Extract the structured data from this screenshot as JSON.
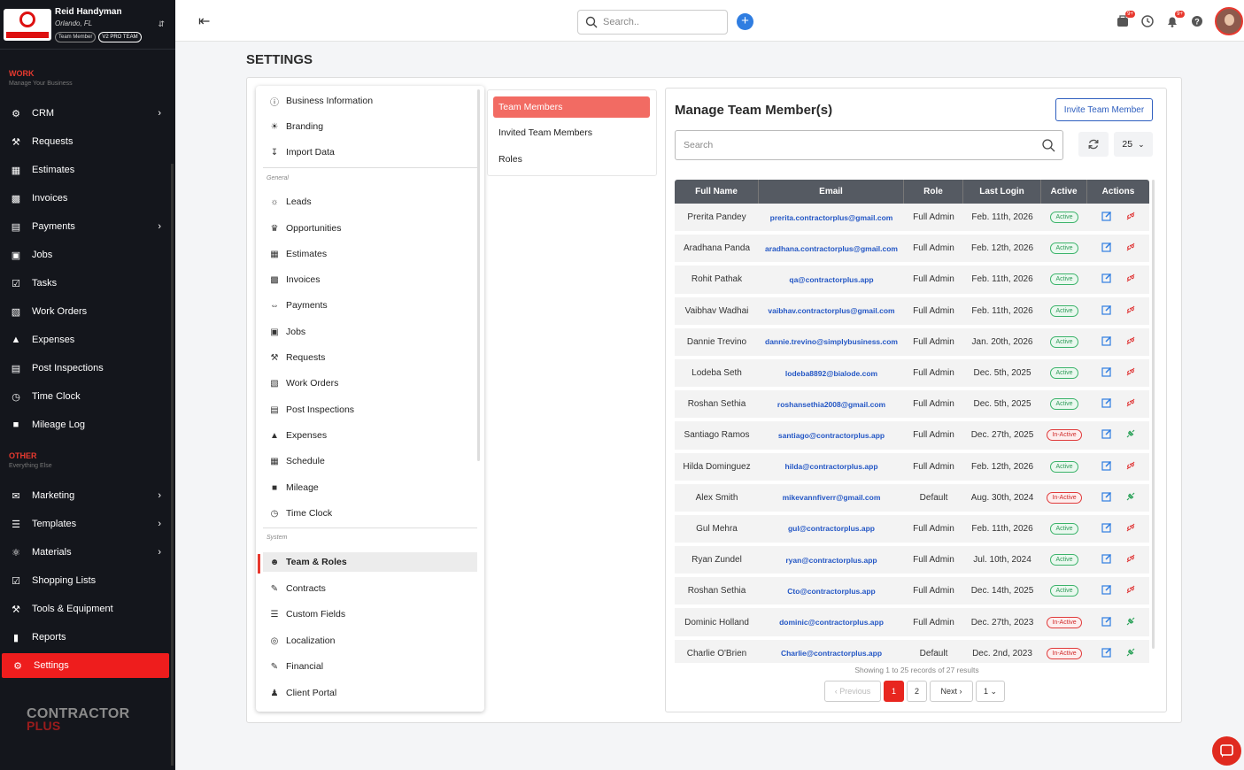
{
  "brand": {
    "name": "Reid Handyman",
    "city": "Orlando, FL",
    "role_badge": "Team Member",
    "plan_badge": "V2 PRO TEAM"
  },
  "sections": {
    "work": {
      "title": "WORK",
      "subtitle": "Manage Your Business"
    },
    "other": {
      "title": "OTHER",
      "subtitle": "Everything Else"
    }
  },
  "nav": [
    {
      "label": "CRM",
      "icon": "crm-icon",
      "chevron": true
    },
    {
      "label": "Requests",
      "icon": "requests-icon",
      "chevron": false
    },
    {
      "label": "Estimates",
      "icon": "estimates-icon",
      "chevron": false
    },
    {
      "label": "Invoices",
      "icon": "invoices-icon",
      "chevron": false
    },
    {
      "label": "Payments",
      "icon": "payments-icon",
      "chevron": true
    },
    {
      "label": "Jobs",
      "icon": "briefcase-icon",
      "chevron": false
    },
    {
      "label": "Tasks",
      "icon": "tasks-icon",
      "chevron": false
    },
    {
      "label": "Work Orders",
      "icon": "work-orders-icon",
      "chevron": false
    },
    {
      "label": "Expenses",
      "icon": "expenses-icon",
      "chevron": false
    },
    {
      "label": "Post Inspections",
      "icon": "inspections-icon",
      "chevron": false
    },
    {
      "label": "Time Clock",
      "icon": "clock-icon",
      "chevron": false
    },
    {
      "label": "Mileage Log",
      "icon": "mileage-icon",
      "chevron": false
    },
    {
      "label": "Marketing",
      "icon": "marketing-icon",
      "chevron": true
    },
    {
      "label": "Templates",
      "icon": "templates-icon",
      "chevron": true
    },
    {
      "label": "Materials",
      "icon": "materials-icon",
      "chevron": true
    },
    {
      "label": "Shopping Lists",
      "icon": "shopping-icon",
      "chevron": false
    },
    {
      "label": "Tools & Equipment",
      "icon": "tools-icon",
      "chevron": false
    },
    {
      "label": "Reports",
      "icon": "reports-icon",
      "chevron": false
    },
    {
      "label": "Settings",
      "icon": "gear-icon",
      "chevron": false,
      "active": true
    }
  ],
  "footer_logo": {
    "line1": "CONTRACTOR",
    "line2": "PLUS"
  },
  "topbar": {
    "search_placeholder": "Search..",
    "badge1": "9+",
    "badge2": "9+"
  },
  "page_title": "SETTINGS",
  "settings_menu": {
    "top": [
      {
        "label": "Business Information",
        "icon": "info-icon"
      },
      {
        "label": "Branding",
        "icon": "sun-icon"
      },
      {
        "label": "Import Data",
        "icon": "import-icon"
      }
    ],
    "general_title": "General",
    "general": [
      {
        "label": "Leads",
        "icon": "leads-icon"
      },
      {
        "label": "Opportunities",
        "icon": "trophy-icon"
      },
      {
        "label": "Estimates",
        "icon": "estimates-icon"
      },
      {
        "label": "Invoices",
        "icon": "invoice-icon"
      },
      {
        "label": "Payments",
        "icon": "payments-icon"
      },
      {
        "label": "Jobs",
        "icon": "briefcase-icon"
      },
      {
        "label": "Requests",
        "icon": "requests-icon"
      },
      {
        "label": "Work Orders",
        "icon": "work-orders-icon"
      },
      {
        "label": "Post Inspections",
        "icon": "inspections-icon"
      },
      {
        "label": "Expenses",
        "icon": "expenses-icon"
      },
      {
        "label": "Schedule",
        "icon": "calendar-icon"
      },
      {
        "label": "Mileage",
        "icon": "mileage-icon"
      },
      {
        "label": "Time Clock",
        "icon": "clock-icon"
      }
    ],
    "system_title": "System",
    "system": [
      {
        "label": "Team & Roles",
        "icon": "team-icon",
        "active": true
      },
      {
        "label": "Contracts",
        "icon": "contracts-icon"
      },
      {
        "label": "Custom Fields",
        "icon": "fields-icon"
      },
      {
        "label": "Localization",
        "icon": "globe-icon"
      },
      {
        "label": "Financial",
        "icon": "financial-icon"
      },
      {
        "label": "Client Portal",
        "icon": "portal-icon"
      }
    ]
  },
  "tabs": [
    {
      "label": "Team Members",
      "active": true
    },
    {
      "label": "Invited Team Members"
    },
    {
      "label": "Roles"
    }
  ],
  "panel": {
    "title": "Manage Team Member(s)",
    "invite_label": "Invite Team Member",
    "search_placeholder": "Search",
    "page_size": "25"
  },
  "table": {
    "headers": [
      "Full Name",
      "Email",
      "Role",
      "Last Login",
      "Active",
      "Actions"
    ],
    "rows": [
      {
        "name": "Prerita Pandey",
        "email": "prerita.contractorplus@gmail.com",
        "role": "Full Admin",
        "last_login": "Feb. 11th, 2026",
        "status": "Active"
      },
      {
        "name": "Aradhana Panda",
        "email": "aradhana.contractorplus@gmail.com",
        "role": "Full Admin",
        "last_login": "Feb. 12th, 2026",
        "status": "Active"
      },
      {
        "name": "Rohit Pathak",
        "email": "qa@contractorplus.app",
        "role": "Full Admin",
        "last_login": "Feb. 11th, 2026",
        "status": "Active"
      },
      {
        "name": "Vaibhav Wadhai",
        "email": "vaibhav.contractorplus@gmail.com",
        "role": "Full Admin",
        "last_login": "Feb. 11th, 2026",
        "status": "Active"
      },
      {
        "name": "Dannie Trevino",
        "email": "dannie.trevino@simplybusiness.com",
        "role": "Full Admin",
        "last_login": "Jan. 20th, 2026",
        "status": "Active"
      },
      {
        "name": "Lodeba Seth",
        "email": "lodeba8892@bialode.com",
        "role": "Full Admin",
        "last_login": "Dec. 5th, 2025",
        "status": "Active"
      },
      {
        "name": "Roshan Sethia",
        "email": "roshansethia2008@gmail.com",
        "role": "Full Admin",
        "last_login": "Dec. 5th, 2025",
        "status": "Active"
      },
      {
        "name": "Santiago Ramos",
        "email": "santiago@contractorplus.app",
        "role": "Full Admin",
        "last_login": "Dec. 27th, 2025",
        "status": "In-Active"
      },
      {
        "name": "Hilda Dominguez",
        "email": "hilda@contractorplus.app",
        "role": "Full Admin",
        "last_login": "Feb. 12th, 2026",
        "status": "Active"
      },
      {
        "name": "Alex Smith",
        "email": "mikevannfiverr@gmail.com",
        "role": "Default",
        "last_login": "Aug. 30th, 2024",
        "status": "In-Active"
      },
      {
        "name": "Gul Mehra",
        "email": "gul@contractorplus.app",
        "role": "Full Admin",
        "last_login": "Feb. 11th, 2026",
        "status": "Active"
      },
      {
        "name": "Ryan Zundel",
        "email": "ryan@contractorplus.app",
        "role": "Full Admin",
        "last_login": "Jul. 10th, 2024",
        "status": "Active"
      },
      {
        "name": "Roshan Sethia",
        "email": "Cto@contractorplus.app",
        "role": "Full Admin",
        "last_login": "Dec. 14th, 2025",
        "status": "Active"
      },
      {
        "name": "Dominic Holland",
        "email": "dominic@contractorplus.app",
        "role": "Full Admin",
        "last_login": "Dec. 27th, 2023",
        "status": "In-Active"
      },
      {
        "name": "Charlie O'Brien",
        "email": "Charlie@contractorplus.app",
        "role": "Default",
        "last_login": "Dec. 2nd, 2023",
        "status": "In-Active"
      }
    ]
  },
  "pagination": {
    "showing": "Showing 1 to 25 records of 27 results",
    "prev": "Previous",
    "pages": [
      "1",
      "2"
    ],
    "next": "Next",
    "page_select": "1"
  },
  "colors": {
    "sidebar_bg": "#14161c",
    "accent_red": "#ee1d1d",
    "active_tab": "#f26b63",
    "link_blue": "#2457c5",
    "table_header": "#555a62"
  }
}
